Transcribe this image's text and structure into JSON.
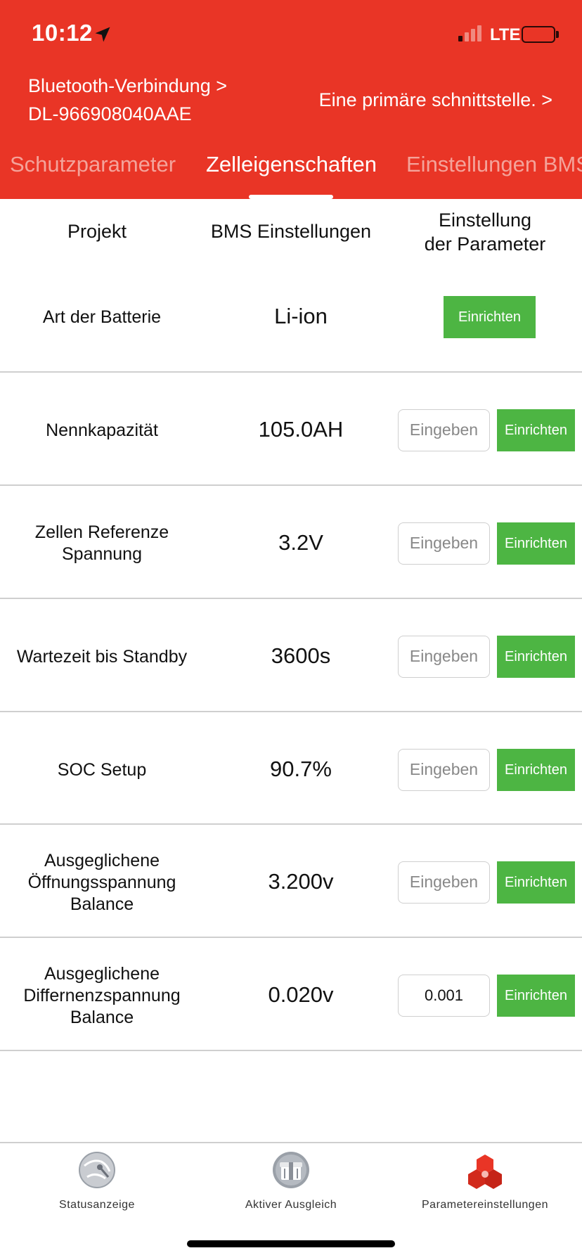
{
  "status_bar": {
    "time": "10:12",
    "network": "LTE"
  },
  "header": {
    "bluetooth_line1": "Bluetooth-Verbindung >",
    "bluetooth_line2": "DL-966908040AAE",
    "interface_link": "Eine primäre schnittstelle. >"
  },
  "tabs": [
    {
      "label": "Schutzparameter",
      "active": false
    },
    {
      "label": "Zelleigenschaften",
      "active": true
    },
    {
      "label": "Einstellungen BMS",
      "active": false
    }
  ],
  "columns": {
    "project": "Projekt",
    "bms_settings": "BMS Einstellungen",
    "param_line1": "Einstellung",
    "param_line2": "der Parameter"
  },
  "rows": [
    {
      "label_lines": [
        "Art der Batterie"
      ],
      "value": "Li-ion",
      "input": null,
      "button": "Einrichten"
    },
    {
      "label_lines": [
        "Nennkapazität"
      ],
      "value": "105.0AH",
      "input": {
        "value": "",
        "placeholder": "Eingeben"
      },
      "button": "Einrichten"
    },
    {
      "label_lines": [
        "Zellen Referenze",
        "Spannung"
      ],
      "value": "3.2V",
      "input": {
        "value": "",
        "placeholder": "Eingeben"
      },
      "button": "Einrichten"
    },
    {
      "label_lines": [
        "Wartezeit bis Standby"
      ],
      "value": "3600s",
      "input": {
        "value": "",
        "placeholder": "Eingeben"
      },
      "button": "Einrichten"
    },
    {
      "label_lines": [
        "SOC Setup"
      ],
      "value": "90.7%",
      "input": {
        "value": "",
        "placeholder": "Eingeben"
      },
      "button": "Einrichten"
    },
    {
      "label_lines": [
        "Ausgeglichene",
        "Öffnungsspannung",
        "Balance"
      ],
      "value": "3.200v",
      "input": {
        "value": "",
        "placeholder": "Eingeben"
      },
      "button": "Einrichten"
    },
    {
      "label_lines": [
        "Ausgeglichene",
        "Differnenzspannung",
        "Balance"
      ],
      "value": "0.020v",
      "input": {
        "value": "0.001",
        "placeholder": "Eingeben"
      },
      "button": "Einrichten"
    }
  ],
  "bottom_nav": [
    {
      "label": "Statusanzeige",
      "icon": "status-gauge-icon"
    },
    {
      "label": "Aktiver Ausgleich",
      "icon": "gift-balance-icon"
    },
    {
      "label": "Parametereinstellungen",
      "icon": "cubes-settings-icon"
    }
  ],
  "colors": {
    "header_red": "#e93526",
    "button_green": "#4db543",
    "tab_inactive": "#f4a39a"
  }
}
